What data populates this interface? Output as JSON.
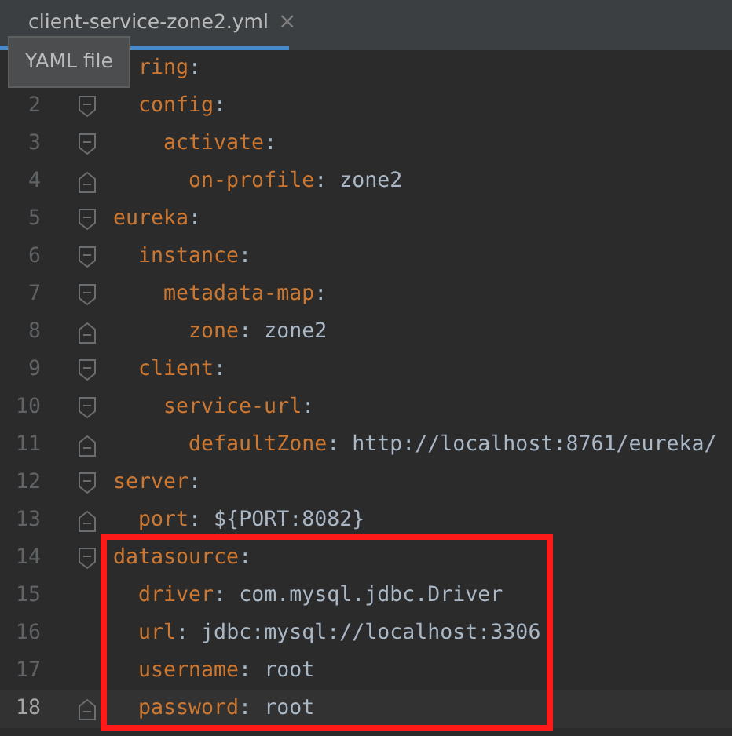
{
  "tab": {
    "title": "client-service-zone2.yml",
    "selected": true,
    "close": "×"
  },
  "tooltip": "YAML file",
  "tree": [
    {
      "key": "ring",
      "colon": ":",
      "covered": true,
      "highlighted": false,
      "current": false,
      "expanded": true,
      "children": [
        {
          "number": "2",
          "key": "config",
          "colon": ":",
          "current": false,
          "expanded": true,
          "children": [
            {
              "number": "3",
              "key": "activate",
              "colon": ":",
              "current": false,
              "expanded": true,
              "children": [
                {
                  "number": "4",
                  "key": "on-profile",
                  "colon": ":",
                  "value": "zone2",
                  "current": false
                }
              ]
            }
          ]
        }
      ]
    },
    {
      "number": "5",
      "key": "eureka",
      "colon": ":",
      "covered": false,
      "highlighted": false,
      "current": false,
      "expanded": true,
      "children": [
        {
          "number": "6",
          "key": "instance",
          "colon": ":",
          "current": false,
          "expanded": true,
          "children": [
            {
              "number": "7",
              "key": "metadata-map",
              "colon": ":",
              "current": false,
              "expanded": true,
              "children": [
                {
                  "number": "8",
                  "key": "zone",
                  "colon": ":",
                  "value": "zone2",
                  "current": false
                }
              ]
            }
          ]
        },
        {
          "number": "9",
          "key": "client",
          "colon": ":",
          "current": false,
          "expanded": true,
          "children": [
            {
              "number": "10",
              "key": "service-url",
              "colon": ":",
              "current": false,
              "expanded": true,
              "children": [
                {
                  "number": "11",
                  "key": "defaultZone",
                  "colon": ":",
                  "value": "http://localhost:8761/eureka/",
                  "current": false
                }
              ]
            }
          ]
        }
      ]
    },
    {
      "number": "12",
      "key": "server",
      "colon": ":",
      "covered": false,
      "highlighted": false,
      "current": false,
      "expanded": true,
      "children": [
        {
          "number": "13",
          "key": "port",
          "colon": ":",
          "value": "${PORT:8082}",
          "current": false
        }
      ]
    },
    {
      "number": "14",
      "key": "datasource",
      "colon": ":",
      "covered": false,
      "highlighted": true,
      "current": false,
      "expanded": true,
      "children": [
        {
          "number": "15",
          "key": "driver",
          "colon": ":",
          "value": "com.mysql.jdbc.Driver",
          "current": false
        },
        {
          "number": "16",
          "key": "url",
          "colon": ":",
          "value": "jdbc:mysql://localhost:3306",
          "current": false
        },
        {
          "number": "17",
          "key": "username",
          "colon": ":",
          "value": "root",
          "current": false
        },
        {
          "number": "18",
          "key": "password",
          "colon": ":",
          "value": "root",
          "current": true
        }
      ]
    }
  ]
}
